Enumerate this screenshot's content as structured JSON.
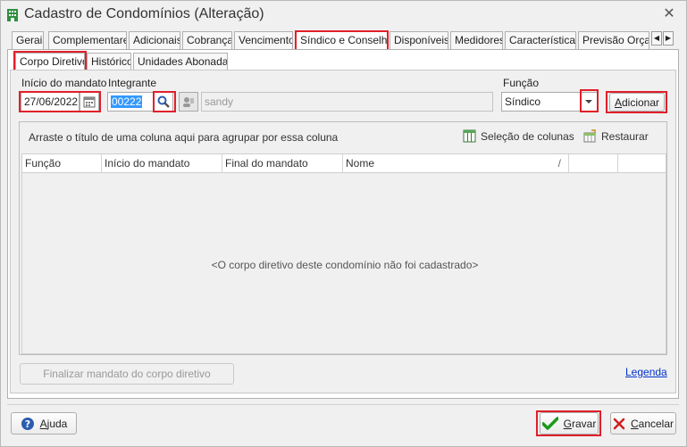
{
  "window": {
    "title": "Cadastro de Condomínios (Alteração)"
  },
  "main_tabs": [
    "Gerais",
    "Complementares",
    "Adicionais",
    "Cobrança",
    "Vencimento",
    "Síndico e Conselho",
    "Disponíveis",
    "Medidores",
    "Características",
    "Previsão Orçam"
  ],
  "sub_tabs": [
    "Corpo Diretivo",
    "Histórico",
    "Unidades Abonadas"
  ],
  "form": {
    "inicio_label": "Início do mandato",
    "inicio_value": "27/06/2022",
    "integrante_label": "Integrante",
    "integrante_code": "00222",
    "integrante_name": "sandy",
    "funcao_label": "Função",
    "funcao_value": "Síndico",
    "adicionar_label": "Adicionar"
  },
  "grid": {
    "group_hint": "Arraste o título de uma coluna aqui para agrupar por essa coluna",
    "selecao_label": "Seleção de colunas",
    "restaurar_label": "Restaurar",
    "columns": [
      "Função",
      "Início do mandato",
      "Final do mandato",
      "Nome"
    ],
    "sort_indicator": "/",
    "empty_message": "<O corpo diretivo deste condomínio não foi cadastrado>"
  },
  "actions": {
    "finalizar_label": "Finalizar mandato do corpo diretivo",
    "legenda_label": "Legenda",
    "ajuda_label": "Ajuda",
    "gravar_label": "Gravar",
    "cancelar_label": "Cancelar"
  },
  "colors": {
    "highlight": "#e01f2a",
    "selection": "#3399ff",
    "link": "#0033cc",
    "confirm_check": "#1a9a1a",
    "cancel_x": "#d02020",
    "help_icon": "#2a5db0"
  }
}
